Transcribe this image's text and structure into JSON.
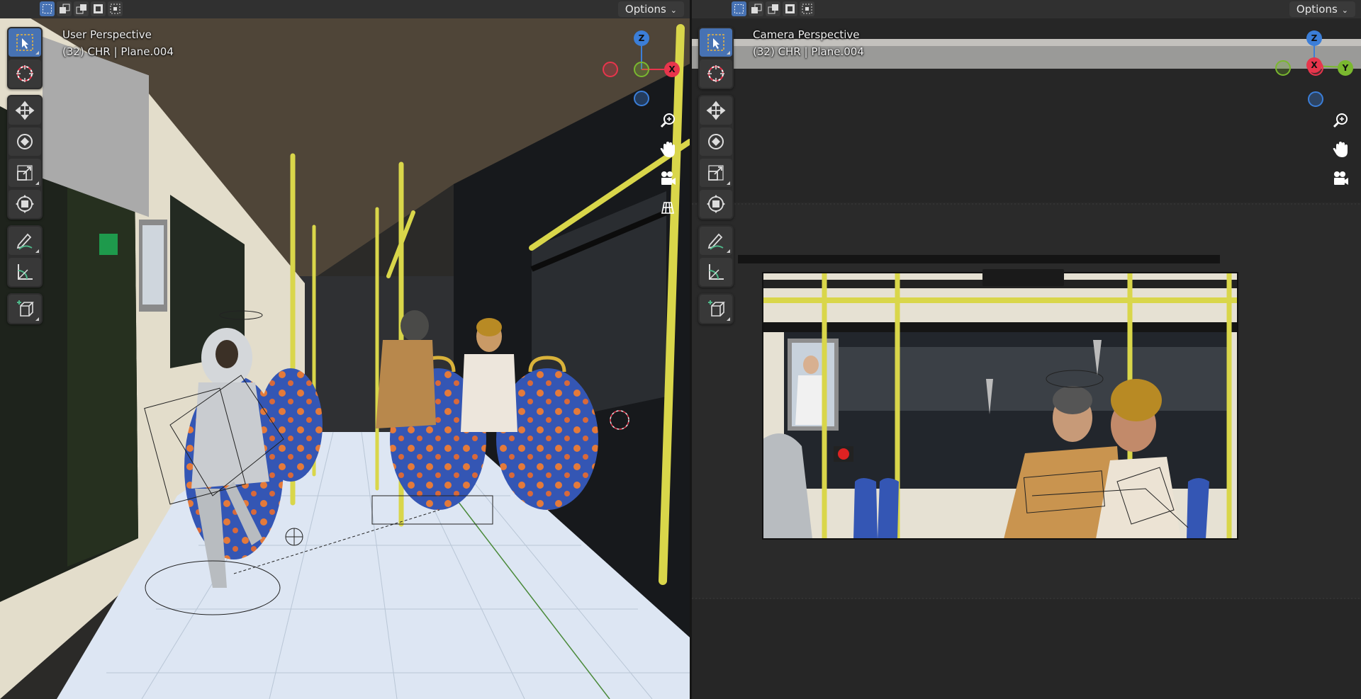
{
  "left_viewport": {
    "view_name": "User Perspective",
    "object_info": "(32) CHR | Plane.004",
    "options_label": "Options"
  },
  "right_viewport": {
    "view_name": "Camera Perspective",
    "object_info": "(32) CHR | Plane.004",
    "options_label": "Options"
  },
  "gizmo_left": {
    "z": "Z",
    "x": "X"
  },
  "gizmo_right": {
    "z": "Z",
    "x": "X",
    "y": "Y"
  },
  "toolbar_tools": [
    "select-box",
    "cursor",
    "move",
    "rotate",
    "scale",
    "transform",
    "annotate",
    "measure",
    "add-cube"
  ],
  "nav_icons": [
    "zoom-icon",
    "pan-hand-icon",
    "camera-icon",
    "grid-icon"
  ],
  "colors": {
    "accent": "#4772b3",
    "axis_x": "#e8354c",
    "axis_y": "#7ab82f",
    "axis_z": "#3b7ed8",
    "pole_yellow": "#d9d64a",
    "seat_blue": "#3456b4",
    "seat_orange": "#e47a3a",
    "floor": "#dde6f3"
  }
}
